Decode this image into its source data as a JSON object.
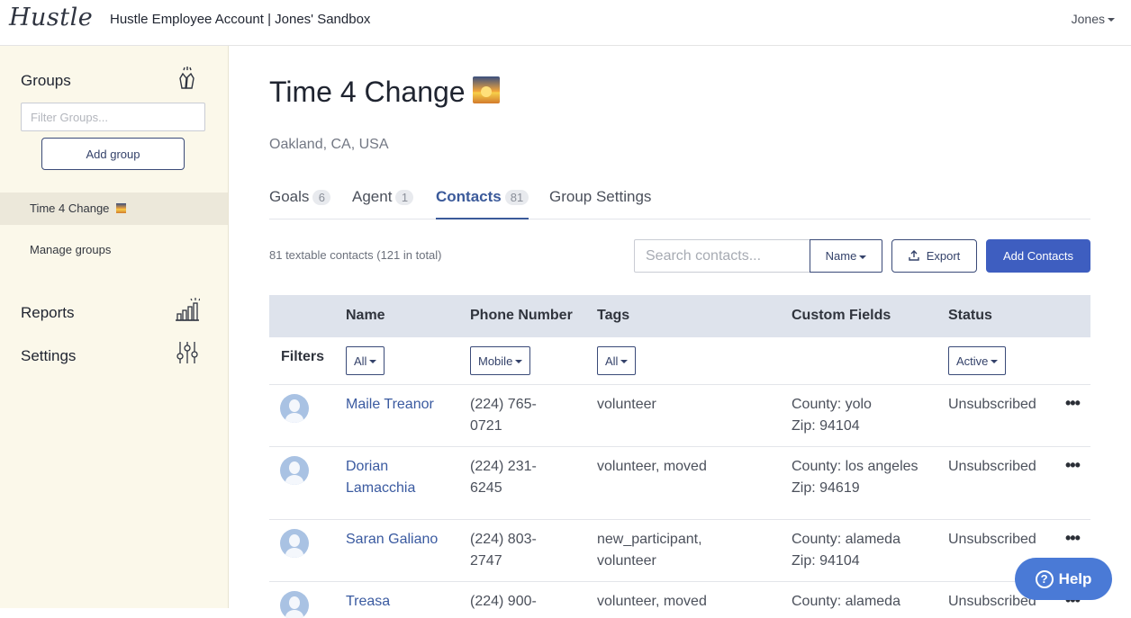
{
  "header": {
    "logo": "Hustle",
    "account": "Hustle Employee Account | Jones' Sandbox",
    "user": "Jones"
  },
  "sidebar": {
    "groups_title": "Groups",
    "filter_placeholder": "Filter Groups...",
    "add_group_label": "Add group",
    "items": [
      {
        "label": "Time 4 Change"
      },
      {
        "label": "Manage groups"
      }
    ],
    "reports_label": "Reports",
    "settings_label": "Settings"
  },
  "group": {
    "title": "Time 4 Change",
    "location": "Oakland, CA, USA"
  },
  "tabs": [
    {
      "label": "Goals",
      "count": "6"
    },
    {
      "label": "Agent",
      "count": "1"
    },
    {
      "label": "Contacts",
      "count": "81"
    },
    {
      "label": "Group Settings"
    }
  ],
  "toolbar": {
    "summary": "81 textable contacts (121 in total)",
    "search_placeholder": "Search contacts...",
    "name_dropdown": "Name",
    "export_label": "Export",
    "add_contacts_label": "Add Contacts"
  },
  "table": {
    "headers": [
      "Name",
      "Phone Number",
      "Tags",
      "Custom Fields",
      "Status"
    ],
    "filters_label": "Filters",
    "filters": {
      "name": "All",
      "phone": "Mobile",
      "tags": "All",
      "status": "Active"
    },
    "rows": [
      {
        "name": "Maile Treanor",
        "phone": "(224) 765-0721",
        "tags": "volunteer",
        "county": "County: yolo",
        "zip": "Zip: 94104",
        "status": "Unsubscribed",
        "more": "•••"
      },
      {
        "name": "Dorian Lamacchia",
        "phone": "(224) 231-6245",
        "tags": "volunteer, moved",
        "county": "County: los angeles",
        "zip": "Zip: 94619",
        "status": "Unsubscribed",
        "more": "•••"
      },
      {
        "name": "Saran Galiano",
        "phone": "(224) 803-2747",
        "tags": "new_participant, volunteer",
        "county": "County: alameda",
        "zip": "Zip: 94104",
        "status": "Unsubscribed",
        "more": "•••"
      },
      {
        "name": "Treasa",
        "phone": "(224) 900-",
        "tags": "volunteer, moved",
        "county": "County: alameda",
        "zip": "",
        "status": "Unsubscribed",
        "more": "•••"
      }
    ]
  },
  "help_label": "Help",
  "icons": {
    "groups": "high-five-icon",
    "reports": "bar-chart-icon",
    "settings": "sliders-icon",
    "title": "sunrise-emoji-icon",
    "export": "export-icon",
    "help": "question-icon"
  },
  "colors": {
    "primary": "#3e5ec0",
    "link": "#3a5aa0",
    "sidebar_bg": "#fbf8ea",
    "table_header_bg": "#dee3ec",
    "help_bg": "#4a7ad6"
  }
}
